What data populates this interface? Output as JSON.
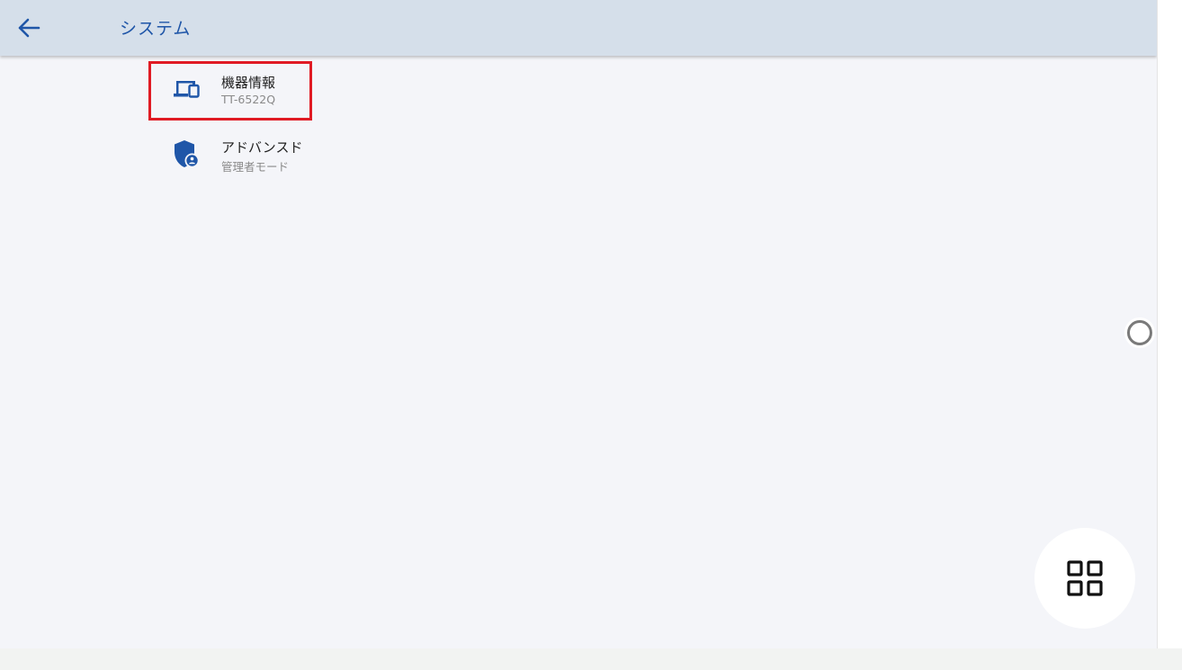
{
  "topbar": {
    "back_icon": "arrow-left-icon",
    "title": "システム"
  },
  "items": [
    {
      "icon": "devices-icon",
      "title": "機器情報",
      "subtitle": "TT-6522Q",
      "highlighted": true
    },
    {
      "icon": "admin-shield-icon",
      "title": "アドバンスド",
      "subtitle": "管理者モード",
      "highlighted": false
    }
  ],
  "floating": {
    "assistive_touch_icon": "assistive-touch-icon",
    "apps_button_icon": "grid-apps-icon"
  },
  "colors": {
    "accent": "#1f56a8",
    "topbar_bg": "#d5dfea",
    "highlight": "#e01b24",
    "background": "#f4f5f9"
  }
}
